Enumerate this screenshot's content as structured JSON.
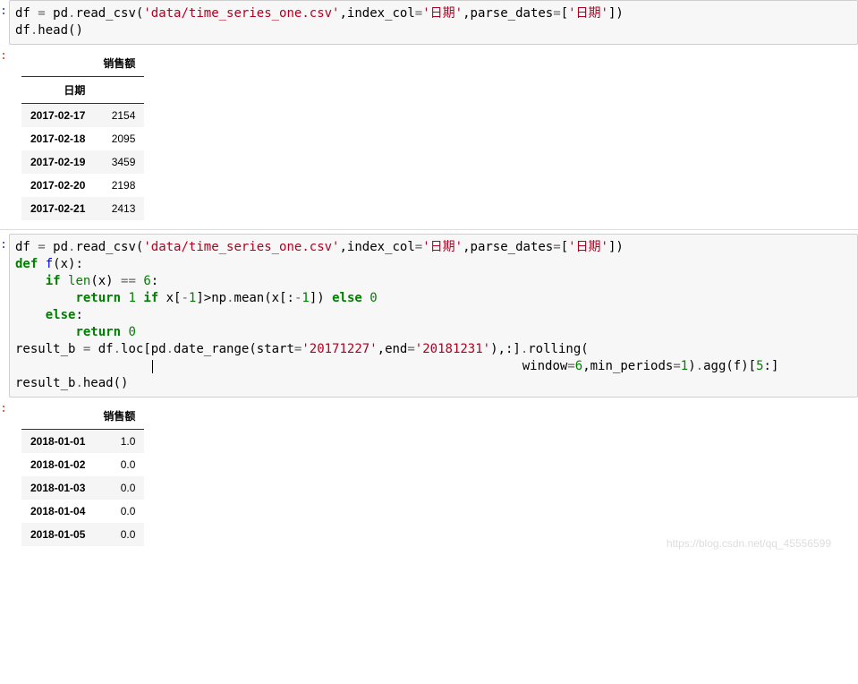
{
  "cell1": {
    "prompt": ":",
    "code": {
      "l1_a": "df ",
      "l1_op1": "=",
      "l1_b": " pd",
      "l1_c": ".",
      "l1_d": "read_csv",
      "l1_e": "(",
      "l1_str1": "'data/time_series_one.csv'",
      "l1_f": ",index_col",
      "l1_g": "=",
      "l1_str2": "'日期'",
      "l1_h": ",parse_dates",
      "l1_i": "=",
      "l1_j": "[",
      "l1_str3": "'日期'",
      "l1_k": "])",
      "l2_a": "df",
      "l2_b": ".",
      "l2_c": "head",
      "l2_d": "()"
    }
  },
  "out1": {
    "prompt": ":",
    "table": {
      "col_header": "销售额",
      "index_name": "日期",
      "rows": [
        {
          "date": "2017-02-17",
          "val": "2154"
        },
        {
          "date": "2017-02-18",
          "val": "2095"
        },
        {
          "date": "2017-02-19",
          "val": "3459"
        },
        {
          "date": "2017-02-20",
          "val": "2198"
        },
        {
          "date": "2017-02-21",
          "val": "2413"
        }
      ]
    }
  },
  "cell2": {
    "prompt": ":",
    "code": {
      "l1_a": "df ",
      "l1_op1": "=",
      "l1_b": " pd",
      "l1_c": ".",
      "l1_d": "read_csv",
      "l1_e": "(",
      "l1_str1": "'data/time_series_one.csv'",
      "l1_f": ",index_col",
      "l1_g": "=",
      "l1_str2": "'日期'",
      "l1_h": ",parse_dates",
      "l1_i": "=",
      "l1_j": "[",
      "l1_str3": "'日期'",
      "l1_k": "])",
      "l2_def": "def",
      "l2_sp": " ",
      "l2_name": "f",
      "l2_paren": "(x)",
      "l2_colon": ":",
      "l3_if": "if",
      "l3_sp": " ",
      "l3_len": "len",
      "l3_rest": "(x) ",
      "l3_eq": "==",
      "l3_sp2": " ",
      "l3_six": "6",
      "l3_c": ":",
      "l4_ret": "return",
      "l4_sp": " ",
      "l4_one": "1",
      "l4_sp2": " ",
      "l4_if": "if",
      "l4_sp3": " x[",
      "l4_m1": "-",
      "l4_one2": "1",
      "l4_rest": "]>np",
      "l4_d": ".",
      "l4_mean": "mean",
      "l4_paren": "(x[:",
      "l4_m2": "-",
      "l4_one3": "1",
      "l4_end": "]) ",
      "l4_else": "else",
      "l4_sp4": " ",
      "l4_zero": "0",
      "l5_else": "else",
      "l5_c": ":",
      "l6_ret": "return",
      "l6_sp": " ",
      "l6_zero": "0",
      "l7_a": "result_b ",
      "l7_op": "=",
      "l7_b": " df",
      "l7_c": ".",
      "l7_d": "loc[pd",
      "l7_e": ".",
      "l7_f": "date_range(start",
      "l7_g": "=",
      "l7_str1": "'20171227'",
      "l7_h": ",end",
      "l7_i": "=",
      "l7_str2": "'20181231'",
      "l7_j": "),:]",
      "l7_k": ".",
      "l7_l": "rolling(",
      "l8_pad": "                                                 ",
      "l8_a": "window",
      "l8_op1": "=",
      "l8_six": "6",
      "l8_b": ",min_periods",
      "l8_op2": "=",
      "l8_one": "1",
      "l8_c": ")",
      "l8_d": ".",
      "l8_e": "agg(f)[",
      "l8_five": "5",
      "l8_f": ":]",
      "l9_a": "result_b",
      "l9_b": ".",
      "l9_c": "head()"
    }
  },
  "out2": {
    "prompt": ":",
    "table": {
      "col_header": "销售额",
      "rows": [
        {
          "date": "2018-01-01",
          "val": "1.0"
        },
        {
          "date": "2018-01-02",
          "val": "0.0"
        },
        {
          "date": "2018-01-03",
          "val": "0.0"
        },
        {
          "date": "2018-01-04",
          "val": "0.0"
        },
        {
          "date": "2018-01-05",
          "val": "0.0"
        }
      ]
    }
  },
  "watermark": "https://blog.csdn.net/qq_45556599"
}
